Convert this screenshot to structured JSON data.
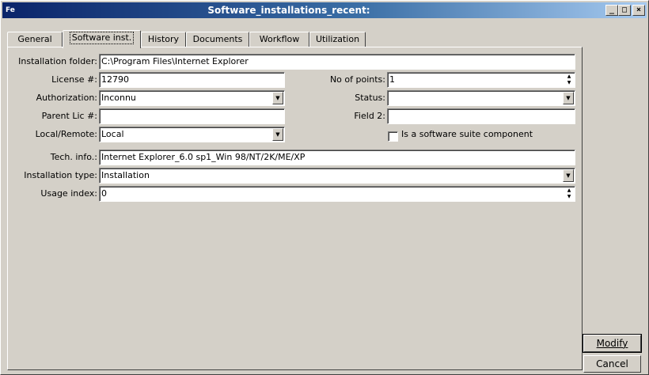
{
  "window": {
    "title": "Software_installations_recent:",
    "minimize": "_",
    "maximize": "□",
    "close": "×"
  },
  "tabs": [
    {
      "label": "General",
      "active": false
    },
    {
      "label": "Software inst.",
      "active": true
    },
    {
      "label": "History",
      "active": false
    },
    {
      "label": "Documents",
      "active": false
    },
    {
      "label": "Workflow",
      "active": false
    },
    {
      "label": "Utilization",
      "active": false
    }
  ],
  "form": {
    "installation_folder": {
      "label": "Installation folder:",
      "value": "C:\\Program Files\\Internet Explorer"
    },
    "license": {
      "label": "License #:",
      "value": "12790"
    },
    "no_of_points": {
      "label": "No of points:",
      "value": "1"
    },
    "authorization": {
      "label": "Authorization:",
      "value": "Inconnu"
    },
    "status": {
      "label": "Status:",
      "value": ""
    },
    "parent_lic": {
      "label": "Parent Lic #:",
      "value": ""
    },
    "field2": {
      "label": "Field 2:",
      "value": ""
    },
    "local_remote": {
      "label": "Local/Remote:",
      "value": "Local"
    },
    "suite_component": {
      "label": "Is a software suite component",
      "checked": false
    },
    "tech_info": {
      "label": "Tech. info.:",
      "value": "Internet Explorer_6.0 sp1_Win 98/NT/2K/ME/XP"
    },
    "installation_type": {
      "label": "Installation type:",
      "value": "Installation"
    },
    "usage_index": {
      "label": "Usage index:",
      "value": "0"
    }
  },
  "buttons": {
    "modify": "Modify",
    "cancel": "Cancel"
  },
  "icons": {
    "app": "app-window-icon",
    "dropdown": "dropdown-arrow-icon",
    "spin": "spin-arrows-icon"
  }
}
